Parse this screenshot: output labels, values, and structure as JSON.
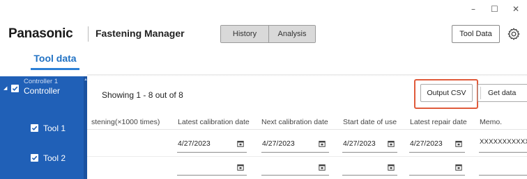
{
  "window_controls": {
    "minimize": "–",
    "maximize": "☐",
    "close": "✕"
  },
  "header": {
    "brand": "Panasonic",
    "app_title": "Fastening Manager",
    "history_label": "History",
    "analysis_label": "Analysis",
    "tool_data_label": "Tool Data",
    "settings_icon": "gear-icon"
  },
  "page_tab": {
    "label": "Tool data"
  },
  "sidebar": {
    "controller": {
      "line1": "Controller 1",
      "line2": "Controller"
    },
    "tools": [
      {
        "label": "Tool 1"
      },
      {
        "label": "Tool 2"
      }
    ]
  },
  "main": {
    "showing_text": "Showing 1 - 8 out of 8",
    "output_csv_label": "Output CSV",
    "get_data_label": "Get data",
    "columns": [
      "stening(×1000 times)",
      "Latest calibration date",
      "Next calibration date",
      "Start date of use",
      "Latest repair date",
      "Memo."
    ],
    "rows": [
      {
        "latest_calibration": "4/27/2023",
        "next_calibration": "4/27/2023",
        "start_of_use": "4/27/2023",
        "latest_repair": "4/27/2023",
        "memo": "XXXXXXXXXXX"
      },
      {
        "latest_calibration": "",
        "next_calibration": "",
        "start_of_use": "",
        "latest_repair": "",
        "memo": ""
      }
    ]
  },
  "colors": {
    "sidebar_bg": "#2060b7",
    "accent": "#2b7fd6",
    "highlight": "#e05a3a"
  }
}
